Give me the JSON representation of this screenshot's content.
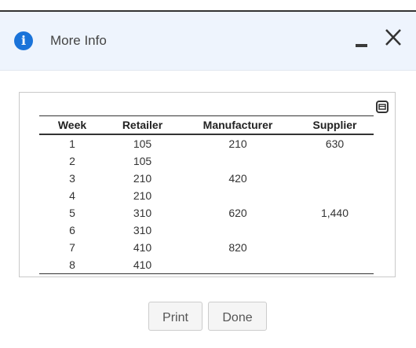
{
  "dialog": {
    "title": "More Info",
    "accent_color": "#1a73d9",
    "header_background": "#eef4fd",
    "icons": {
      "info": "info-icon",
      "minimize": "minimize-icon",
      "close": "close-icon",
      "expand": "expand-icon"
    }
  },
  "table": {
    "columns": [
      "Week",
      "Retailer",
      "Manufacturer",
      "Supplier"
    ],
    "rows": [
      [
        "1",
        "105",
        "210",
        "630"
      ],
      [
        "2",
        "105",
        "",
        ""
      ],
      [
        "3",
        "210",
        "420",
        ""
      ],
      [
        "4",
        "210",
        "",
        ""
      ],
      [
        "5",
        "310",
        "620",
        "1,440"
      ],
      [
        "6",
        "310",
        "",
        ""
      ],
      [
        "7",
        "410",
        "820",
        ""
      ],
      [
        "8",
        "410",
        "",
        ""
      ]
    ]
  },
  "footer": {
    "print_label": "Print",
    "done_label": "Done"
  }
}
